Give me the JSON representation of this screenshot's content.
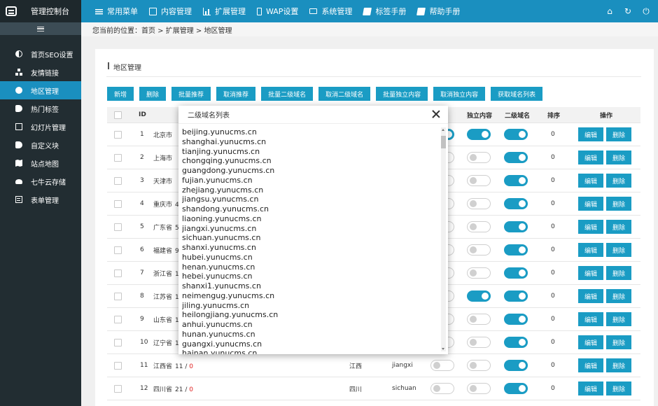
{
  "header": {
    "title": "管理控制台",
    "nav": [
      {
        "label": "常用菜单",
        "icon": "grid-icon"
      },
      {
        "label": "内容管理",
        "icon": "edit-icon"
      },
      {
        "label": "扩展管理",
        "icon": "chart-icon"
      },
      {
        "label": "WAP设置",
        "icon": "mobile-icon"
      },
      {
        "label": "系统管理",
        "icon": "monitor-icon"
      },
      {
        "label": "标签手册",
        "icon": "book-icon"
      },
      {
        "label": "帮助手册",
        "icon": "book-icon"
      }
    ],
    "right_icons": [
      "home-icon",
      "refresh-icon",
      "power-icon"
    ]
  },
  "sidebar": {
    "items": [
      {
        "label": "首页SEO设置",
        "icon": "half-circle-icon"
      },
      {
        "label": "友情链接",
        "icon": "sitemap-icon"
      },
      {
        "label": "地区管理",
        "icon": "globe-icon",
        "active": true
      },
      {
        "label": "热门标签",
        "icon": "tag-icon"
      },
      {
        "label": "幻灯片管理",
        "icon": "image-icon"
      },
      {
        "label": "自定义块",
        "icon": "tag-icon"
      },
      {
        "label": "站点地图",
        "icon": "map-icon"
      },
      {
        "label": "七牛云存储",
        "icon": "cloud-icon"
      },
      {
        "label": "表单管理",
        "icon": "form-icon"
      }
    ]
  },
  "breadcrumb": "您当前的位置：首页 > 扩展管理 > 地区管理",
  "panel": {
    "title": "地区管理",
    "buttons": [
      "新增",
      "删除",
      "批量推荐",
      "取消推荐",
      "批量二级域名",
      "取消二级域名",
      "批量独立内容",
      "取消独立内容",
      "获取域名列表"
    ],
    "columns": {
      "id": "ID",
      "independent": "独立内容",
      "subdomain": "二级域名",
      "sort": "排序",
      "actions": "操作"
    },
    "edit_label": "编辑",
    "delete_label": "删除",
    "rows": [
      {
        "id": "1",
        "name": "北京市",
        "extra": "",
        "count_a": "",
        "count_b": "",
        "sort": "0",
        "indep": true,
        "sub": true,
        "rec": true,
        "short": "",
        "pinyin": ""
      },
      {
        "id": "2",
        "name": "上海市",
        "extra": "",
        "count_a": "",
        "count_b": "",
        "sort": "0",
        "indep": false,
        "sub": true,
        "rec": false,
        "short": "",
        "pinyin": ""
      },
      {
        "id": "3",
        "name": "天津市",
        "extra": "",
        "count_a": "",
        "count_b": "",
        "sort": "0",
        "indep": false,
        "sub": true,
        "rec": false,
        "short": "",
        "pinyin": ""
      },
      {
        "id": "4",
        "name": "重庆市",
        "extra": "4",
        "count_a": "",
        "count_b": "",
        "sort": "0",
        "indep": false,
        "sub": true,
        "rec": false,
        "short": "",
        "pinyin": ""
      },
      {
        "id": "5",
        "name": "广东省",
        "extra": "5",
        "count_a": "",
        "count_b": "",
        "sort": "0",
        "indep": false,
        "sub": true,
        "rec": false,
        "short": "",
        "pinyin": ""
      },
      {
        "id": "6",
        "name": "福建省",
        "extra": "9",
        "count_a": "",
        "count_b": "",
        "sort": "0",
        "indep": false,
        "sub": true,
        "rec": false,
        "short": "",
        "pinyin": ""
      },
      {
        "id": "7",
        "name": "浙江省",
        "extra": "1",
        "count_a": "",
        "count_b": "",
        "sort": "0",
        "indep": false,
        "sub": true,
        "rec": false,
        "short": "",
        "pinyin": ""
      },
      {
        "id": "8",
        "name": "江苏省",
        "extra": "1",
        "count_a": "",
        "count_b": "",
        "sort": "0",
        "indep": true,
        "sub": true,
        "rec": false,
        "short": "",
        "pinyin": ""
      },
      {
        "id": "9",
        "name": "山东省",
        "extra": "1",
        "count_a": "",
        "count_b": "",
        "sort": "0",
        "indep": false,
        "sub": true,
        "rec": false,
        "short": "",
        "pinyin": ""
      },
      {
        "id": "10",
        "name": "辽宁省",
        "extra": "1",
        "count_a": "",
        "count_b": "",
        "sort": "0",
        "indep": false,
        "sub": true,
        "rec": false,
        "short": "",
        "pinyin": ""
      },
      {
        "id": "11",
        "name": "江西省",
        "extra": "11 / ",
        "count_a": "",
        "count_b": "0",
        "sort": "0",
        "indep": false,
        "sub": true,
        "rec": false,
        "short": "江西",
        "pinyin": "jiangxi"
      },
      {
        "id": "12",
        "name": "四川省",
        "extra": "21 / ",
        "count_a": "",
        "count_b": "0",
        "sort": "0",
        "indep": false,
        "sub": true,
        "rec": false,
        "short": "四川",
        "pinyin": "sichuan"
      }
    ]
  },
  "modal": {
    "title": "二级域名列表",
    "domains": [
      "beijing.yunucms.cn",
      "shanghai.yunucms.cn",
      "tianjing.yunucms.cn",
      "chongqing.yunucms.cn",
      "guangdong.yunucms.cn",
      "fujian.yunucms.cn",
      "zhejiang.yunucms.cn",
      "jiangsu.yunucms.cn",
      "shandong.yunucms.cn",
      "liaoning.yunucms.cn",
      "jiangxi.yunucms.cn",
      "sichuan.yunucms.cn",
      "shanxi.yunucms.cn",
      "hubei.yunucms.cn",
      "henan.yunucms.cn",
      "hebei.yunucms.cn",
      "shanxi1.yunucms.cn",
      "neimengug.yunucms.cn",
      "jiling.yunucms.cn",
      "heilongjiang.yunucms.cn",
      "anhui.yunucms.cn",
      "hunan.yunucms.cn",
      "guangxi.yunucms.cn",
      "hainan.yunucms.cn"
    ]
  }
}
